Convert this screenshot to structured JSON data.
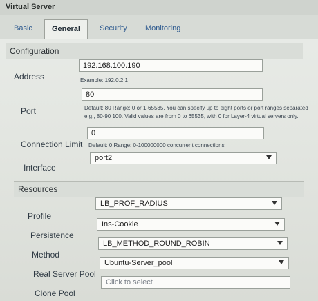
{
  "window": {
    "title": "Virtual Server"
  },
  "tabs": [
    {
      "label": "Basic"
    },
    {
      "label": "General"
    },
    {
      "label": "Security"
    },
    {
      "label": "Monitoring"
    }
  ],
  "configuration": {
    "section_label": "Configuration",
    "address": {
      "label": "Address",
      "value": "192.168.100.190",
      "hint": "Example: 192.0.2.1"
    },
    "port": {
      "label": "Port",
      "value": "80",
      "hint_line1": "Default: 80 Range: 0 or 1-65535. You can specify up to eight ports or port ranges separated",
      "hint_line2": "e.g., 80-90 100. Valid values are from 0 to 65535, with 0 for Layer-4 virtual servers only."
    },
    "connection_limit": {
      "label": "Connection Limit",
      "value": "0",
      "hint": "Default: 0 Range: 0-100000000 concurrent connections"
    },
    "interface": {
      "label": "Interface",
      "value": "port2"
    }
  },
  "resources": {
    "section_label": "Resources",
    "profile": {
      "label": "Profile",
      "value": "LB_PROF_RADIUS"
    },
    "persistence": {
      "label": "Persistence",
      "value": "Ins-Cookie"
    },
    "method": {
      "label": "Method",
      "value": "LB_METHOD_ROUND_ROBIN"
    },
    "real_server_pool": {
      "label": "Real Server Pool",
      "value": "Ubuntu-Server_pool"
    },
    "clone_pool": {
      "label": "Clone Pool",
      "placeholder": "Click to select"
    }
  }
}
